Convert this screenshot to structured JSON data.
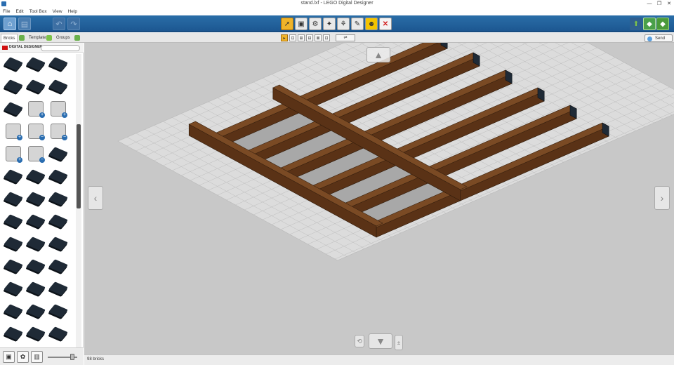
{
  "window": {
    "title": "stand.lxf - LEGO Digital Designer",
    "minimize": "—",
    "restore": "❐",
    "close": "✕"
  },
  "menu": [
    "File",
    "Edit",
    "Tool Box",
    "View",
    "Help"
  ],
  "toolbar": {
    "home_icon": "⌂",
    "save_icon": "▤",
    "undo_icon": "↶",
    "redo_icon": "↷",
    "tools": [
      {
        "name": "select-tool",
        "glyph": "➚",
        "active": true
      },
      {
        "name": "clone-tool",
        "glyph": "▣",
        "active": false
      },
      {
        "name": "hinge-tool",
        "glyph": "⚙",
        "active": false
      },
      {
        "name": "hinge-align-tool",
        "glyph": "✦",
        "active": false
      },
      {
        "name": "flex-tool",
        "glyph": "⚘",
        "active": false
      },
      {
        "name": "paint-tool",
        "glyph": "✎",
        "active": false
      },
      {
        "name": "decoration-tool",
        "glyph": "☻",
        "active": false
      },
      {
        "name": "delete-tool",
        "glyph": "✕",
        "active": false
      }
    ],
    "view_buttons": [
      "⬆",
      "◆",
      "◆"
    ]
  },
  "subbar": {
    "tabs": [
      "Bricks",
      "Templates",
      "Groups"
    ],
    "sub_tools": [
      "▸",
      "⊡",
      "⊞",
      "⊟",
      "⊠",
      "⊡"
    ],
    "wide_button": "⇌",
    "send_label": "Send"
  },
  "palette": {
    "brand": "DIGITAL DESIGNER",
    "search_placeholder": "",
    "rows": [
      [
        "dark",
        "dark",
        "dark"
      ],
      [
        "dark",
        "dark",
        "dark"
      ],
      [
        "dark",
        "light+",
        "light+"
      ],
      [
        "light+",
        "light-",
        "light-"
      ],
      [
        "light+",
        "light-",
        "dark"
      ],
      [
        "dark",
        "dark",
        "dark"
      ],
      [
        "dark",
        "dark",
        "dark"
      ],
      [
        "dark",
        "dark",
        "dark"
      ],
      [
        "dark",
        "dark",
        "dark"
      ],
      [
        "dark",
        "dark",
        "dark"
      ],
      [
        "dark",
        "dark",
        "dark"
      ],
      [
        "dark",
        "dark",
        "dark"
      ],
      [
        "dark",
        "dark",
        "dark"
      ]
    ],
    "bottom_icons": [
      "▣",
      "✿",
      "▥"
    ]
  },
  "canvas": {
    "nav_left": "‹",
    "nav_right": "›",
    "nav_up": "▲",
    "nav_down": "▼",
    "colors": {
      "baseplate": "#dcdcdc",
      "beam": "#5a3216",
      "beam_top": "#7a4a24",
      "plate": "#a8a8a8",
      "background": "#c8c8c8"
    }
  },
  "status": {
    "brick_count": "98 bricks"
  }
}
